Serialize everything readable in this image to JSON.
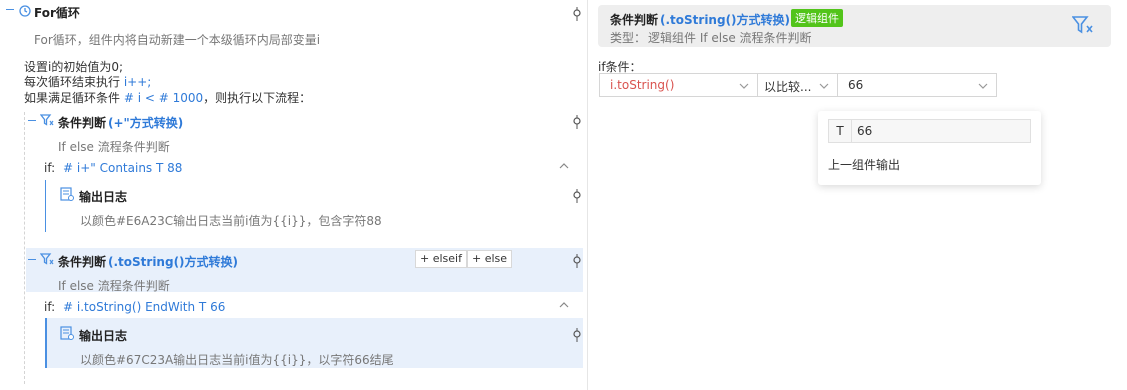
{
  "left": {
    "for_node": {
      "title": "For循环",
      "description": "For循环，组件内将自动新建一个本级循环内局部变量i",
      "init_line": "设置i的初始值为0;",
      "step_prefix": "每次循环结束执行",
      "step_expr": "i++;",
      "cond_prefix": "如果满足循环条件",
      "cond_expr": "# i < # 1000",
      "cond_suffix": "，则执行以下流程："
    },
    "cond1": {
      "title": "条件判断",
      "title_suffix": "(+\"方式转换)",
      "subtitle": "If else 流程条件判断",
      "if_label": "if:",
      "if_expr": "# i+\" Contains T 88",
      "log_title": "输出日志",
      "log_text": "以颜色#E6A23C输出日志当前i值为{{i}}，包含字符88"
    },
    "cond2": {
      "title": "条件判断",
      "title_suffix": "(.toString()方式转换)",
      "elseif_btn": "+ elseif",
      "else_btn": "+ else",
      "subtitle": "If else 流程条件判断",
      "if_label": "if:",
      "if_expr": "# i.toString() EndWith T 66",
      "log_title": "输出日志",
      "log_text": "以颜色#67C23A输出日志当前i值为{{i}}，以字符66结尾"
    }
  },
  "right": {
    "header": {
      "title": "条件判断",
      "title_suffix": "(.toString()方式转换)",
      "badge": "逻辑组件",
      "type_label": "类型：",
      "type_value": "逻辑组件 If else 流程条件判断"
    },
    "if_condition_label": "if条件：",
    "left_operand": "i.toString()",
    "operator": "以比较...",
    "right_operand": "66",
    "dropdown": {
      "type_tag": "T",
      "input_value": "66",
      "option": "上一组件输出"
    }
  },
  "colors": {
    "accent": "#4a90e2",
    "badge": "#52c41a",
    "highlight_row": "#e8f0fb"
  }
}
